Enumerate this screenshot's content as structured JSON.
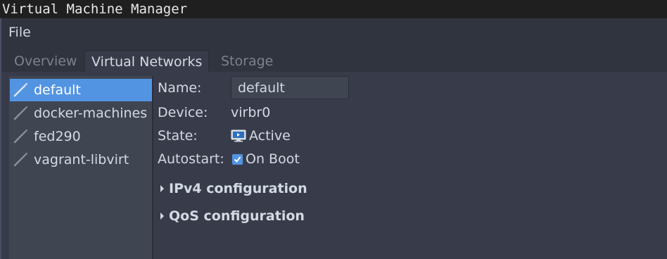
{
  "window": {
    "title": "Virtual Machine Manager"
  },
  "menubar": {
    "file_label": "File"
  },
  "tabs": [
    {
      "label": "Overview",
      "active": false
    },
    {
      "label": "Virtual Networks",
      "active": true
    },
    {
      "label": "Storage",
      "active": false
    }
  ],
  "networks": [
    {
      "label": "default",
      "icon": "network-icon",
      "selected": true
    },
    {
      "label": "docker-machines",
      "icon": "network-icon",
      "selected": false
    },
    {
      "label": "fed290",
      "icon": "network-icon",
      "selected": false
    },
    {
      "label": "vagrant-libvirt",
      "icon": "network-icon",
      "selected": false
    }
  ],
  "details": {
    "name_label": "Name:",
    "name_value": "default",
    "device_label": "Device:",
    "device_value": "virbr0",
    "state_label": "State:",
    "state_value": "Active",
    "state_icon": "monitor-icon",
    "autostart_label": "Autostart:",
    "autostart_value": "On Boot",
    "autostart_checked": true,
    "ipv4_label": "IPv4 configuration",
    "qos_label": "QoS configuration"
  },
  "colors": {
    "accent": "#5294e2",
    "background": "#383c4a",
    "text": "#d3dae3"
  }
}
